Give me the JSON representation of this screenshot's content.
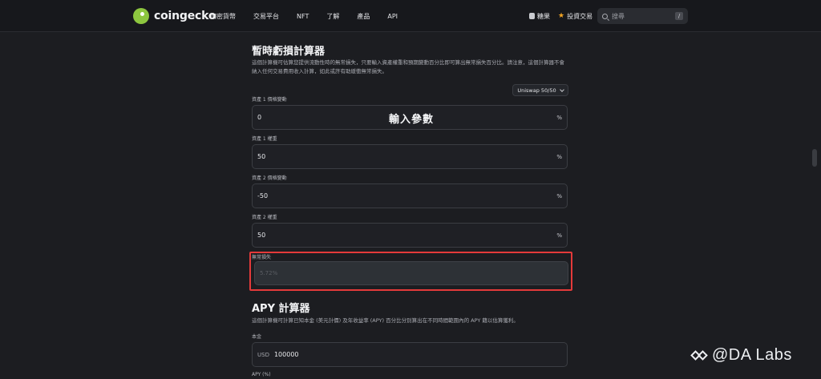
{
  "header": {
    "brand": "coingecko",
    "nav": [
      "加密貨幣",
      "交易平台",
      "NFT",
      "了解",
      "產品",
      "API"
    ],
    "candy_label": "糖果",
    "portfolio_label": "投資交易",
    "search_placeholder": "搜尋",
    "search_shortcut": "/"
  },
  "calculator": {
    "title": "暫時虧損計算器",
    "description": "這個計算機可估算您提供流動性時的無常損失，只要輸入資產權重和預期變動百分比即可算出無常損失百分比。請注意，這個計算器不會納入任何交易費用收入計算，如此或許有助緩衝無常損失。",
    "preset": "Uniswap 50/50",
    "overlay_label": "輸入參數",
    "fields": [
      {
        "label": "資產 1 價格變動",
        "value": "0",
        "unit": "%"
      },
      {
        "label": "資產 1 權重",
        "value": "50",
        "unit": "%"
      },
      {
        "label": "資產 2 價格變動",
        "value": "-50",
        "unit": "%"
      },
      {
        "label": "資產 2 權重",
        "value": "50",
        "unit": "%"
      }
    ],
    "result_label": "無常損失",
    "result_placeholder": "5.72%"
  },
  "apy": {
    "title": "APY 計算器",
    "description": "這個計算機可計算已知本金 (美元計價) 及年收益率 (APY) 百分比分別算出在不同時間範圍內的 APY 藉以估算獲利。",
    "principal_label": "本金",
    "currency": "USD",
    "principal_value": "100000",
    "apy_label": "APY (%)"
  },
  "watermark": "@DA Labs",
  "colors": {
    "background": "#1c1d21",
    "highlight": "#e43a3a",
    "brand": "#8dc63f"
  }
}
